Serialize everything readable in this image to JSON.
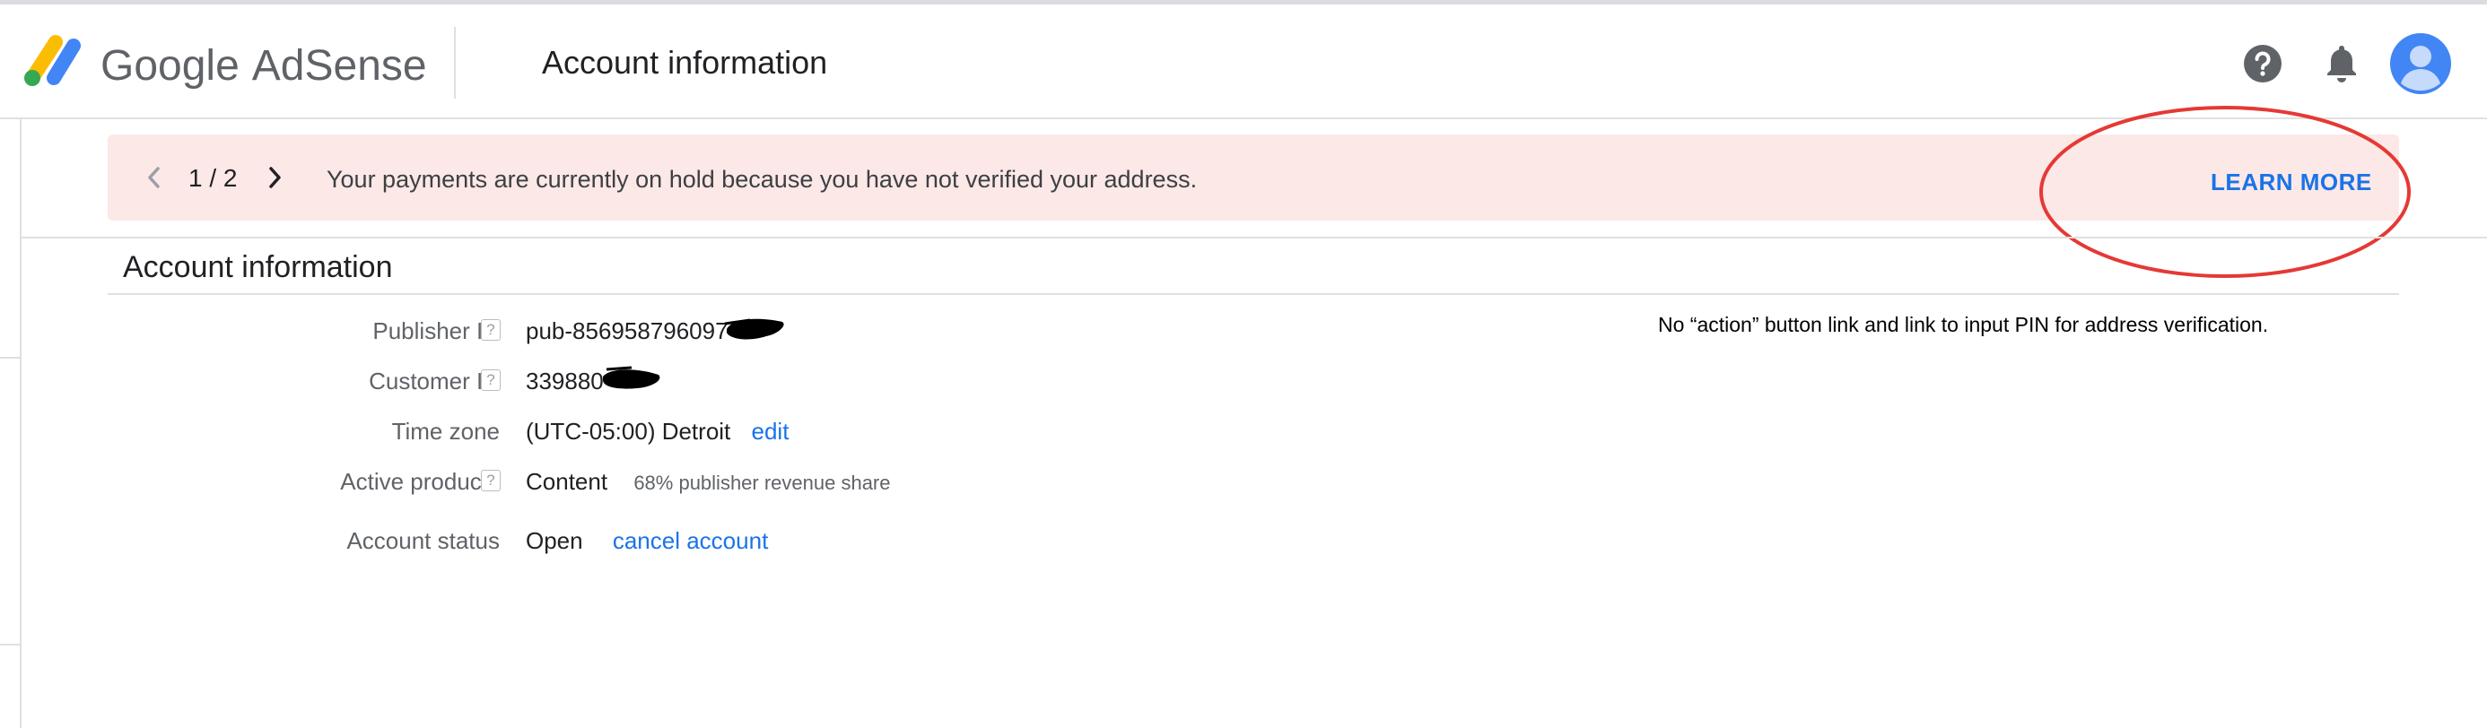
{
  "header": {
    "brand_google": "Google",
    "brand_adsense": "AdSense",
    "page_title": "Account information",
    "icons": [
      "adsense-logo-icon",
      "help-icon",
      "notifications-icon",
      "account-avatar-icon"
    ]
  },
  "banner": {
    "counter": "1 / 2",
    "message": "Your payments are currently on hold because you have not verified your address.",
    "action_label": "LEARN MORE"
  },
  "annotation": {
    "note": "No “action” button link and link to input PIN for address verification."
  },
  "account": {
    "section_title": "Account information",
    "rows": [
      {
        "label": "Publisher ID",
        "help": "?",
        "value": "pub-856958796097"
      },
      {
        "label": "Customer ID",
        "help": "?",
        "value": "339880"
      },
      {
        "label": "Time zone",
        "value": "(UTC-05:00) Detroit",
        "link": "edit"
      },
      {
        "label": "Active products",
        "help": "?",
        "value": "Content",
        "detail": "68% publisher revenue share"
      },
      {
        "label": "Account status",
        "value": "Open",
        "link": "cancel account"
      }
    ]
  },
  "colors": {
    "accent_blue": "#1a73e8",
    "banner_bg": "#fce8e6",
    "annotation_red": "#e53935"
  }
}
